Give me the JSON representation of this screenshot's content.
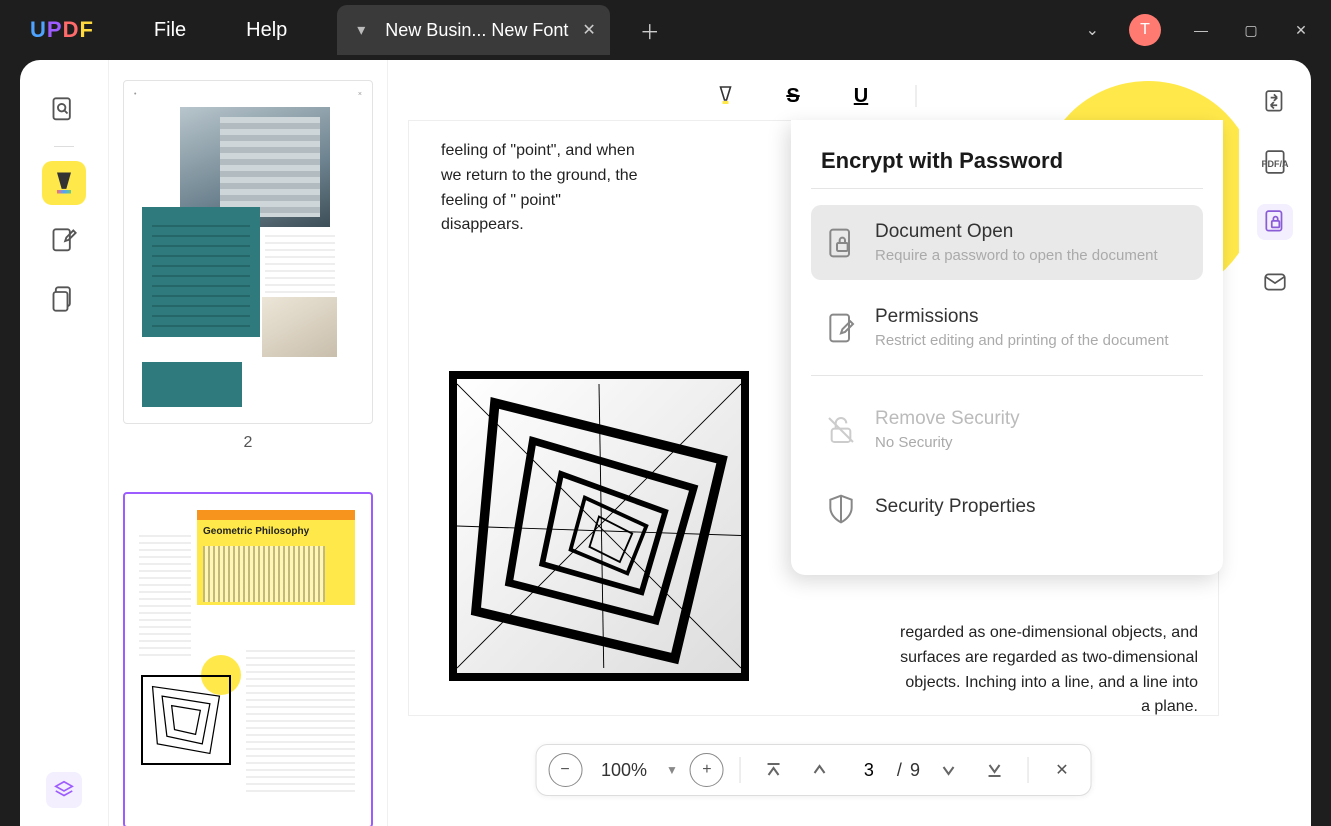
{
  "app": {
    "logo_parts": [
      "U",
      "P",
      "D",
      "F"
    ]
  },
  "menu": {
    "file": "File",
    "help": "Help"
  },
  "tab": {
    "title": "New Busin... New Font"
  },
  "avatar": {
    "initial": "T"
  },
  "thumbs": {
    "page2_label": "2",
    "page3_title": "Geometric Philosophy"
  },
  "page": {
    "text_left": "feeling of \"point\", and when we return to the ground, the feeling of \" point\" disappears.",
    "text_right": "regarded as one-dimensional objects, and surfaces are regarded as two-dimensional objects. Inching into a line, and a line into a plane."
  },
  "pagination": {
    "zoom": "100%",
    "current": "3",
    "separator": "/",
    "total": "9"
  },
  "encrypt": {
    "title": "Encrypt with Password",
    "doc_open": {
      "title": "Document Open",
      "sub": "Require a password to open the document"
    },
    "permissions": {
      "title": "Permissions",
      "sub": "Restrict editing and printing of the document"
    },
    "remove": {
      "title": "Remove Security",
      "sub": "No Security"
    },
    "properties": {
      "title": "Security Properties"
    }
  },
  "right_rail": {
    "pdfa": "PDF/A"
  }
}
